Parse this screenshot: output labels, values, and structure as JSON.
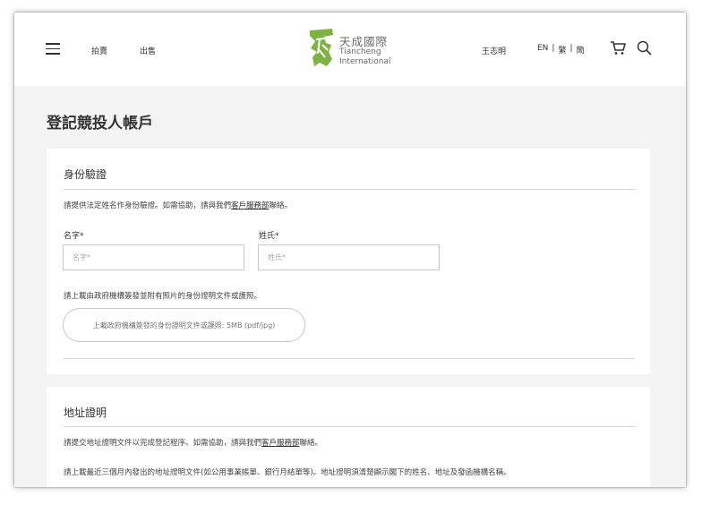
{
  "header": {
    "nav": {
      "auction": "拍賣",
      "sell": "出售"
    },
    "logo": {
      "cn": "天成國際",
      "en_line1": "Tiancheng",
      "en_line2": "International"
    },
    "user": "王志明",
    "lang": {
      "en": "EN",
      "trad": "繁",
      "simp": "簡"
    }
  },
  "page": {
    "title": "登記競投人帳戶"
  },
  "identity": {
    "title": "身份驗證",
    "hint_prefix": "請提供法定姓名作身份驗證。如需協助，請與我們",
    "hint_link": "客戶服務部",
    "hint_suffix": "聯絡。",
    "first_name_label": "名字*",
    "first_name_placeholder": "名字*",
    "last_name_label": "姓氏*",
    "last_name_placeholder": "姓氏*",
    "upload_instruction": "請上載由政府機構簽發並附有照片的身份證明文件或護照。",
    "upload_button": "上載政府機構簽發的身份證明文件或護照: 5MB (pdf/jpg)"
  },
  "address": {
    "title": "地址證明",
    "hint_prefix": "請提交地址證明文件以完成登記程序。如需協助，請與我們",
    "hint_link": "客戶服務部",
    "hint_suffix": "聯絡。",
    "upload_instruction": "請上載最近三個月內發出的地址證明文件(如公用事業帳單、銀行月結單等)。地址證明須清楚顯示閣下的姓名、地址及發函機構名稱。"
  },
  "colors": {
    "brand_green": "#7cb342",
    "page_bg": "#f4f4f4"
  }
}
